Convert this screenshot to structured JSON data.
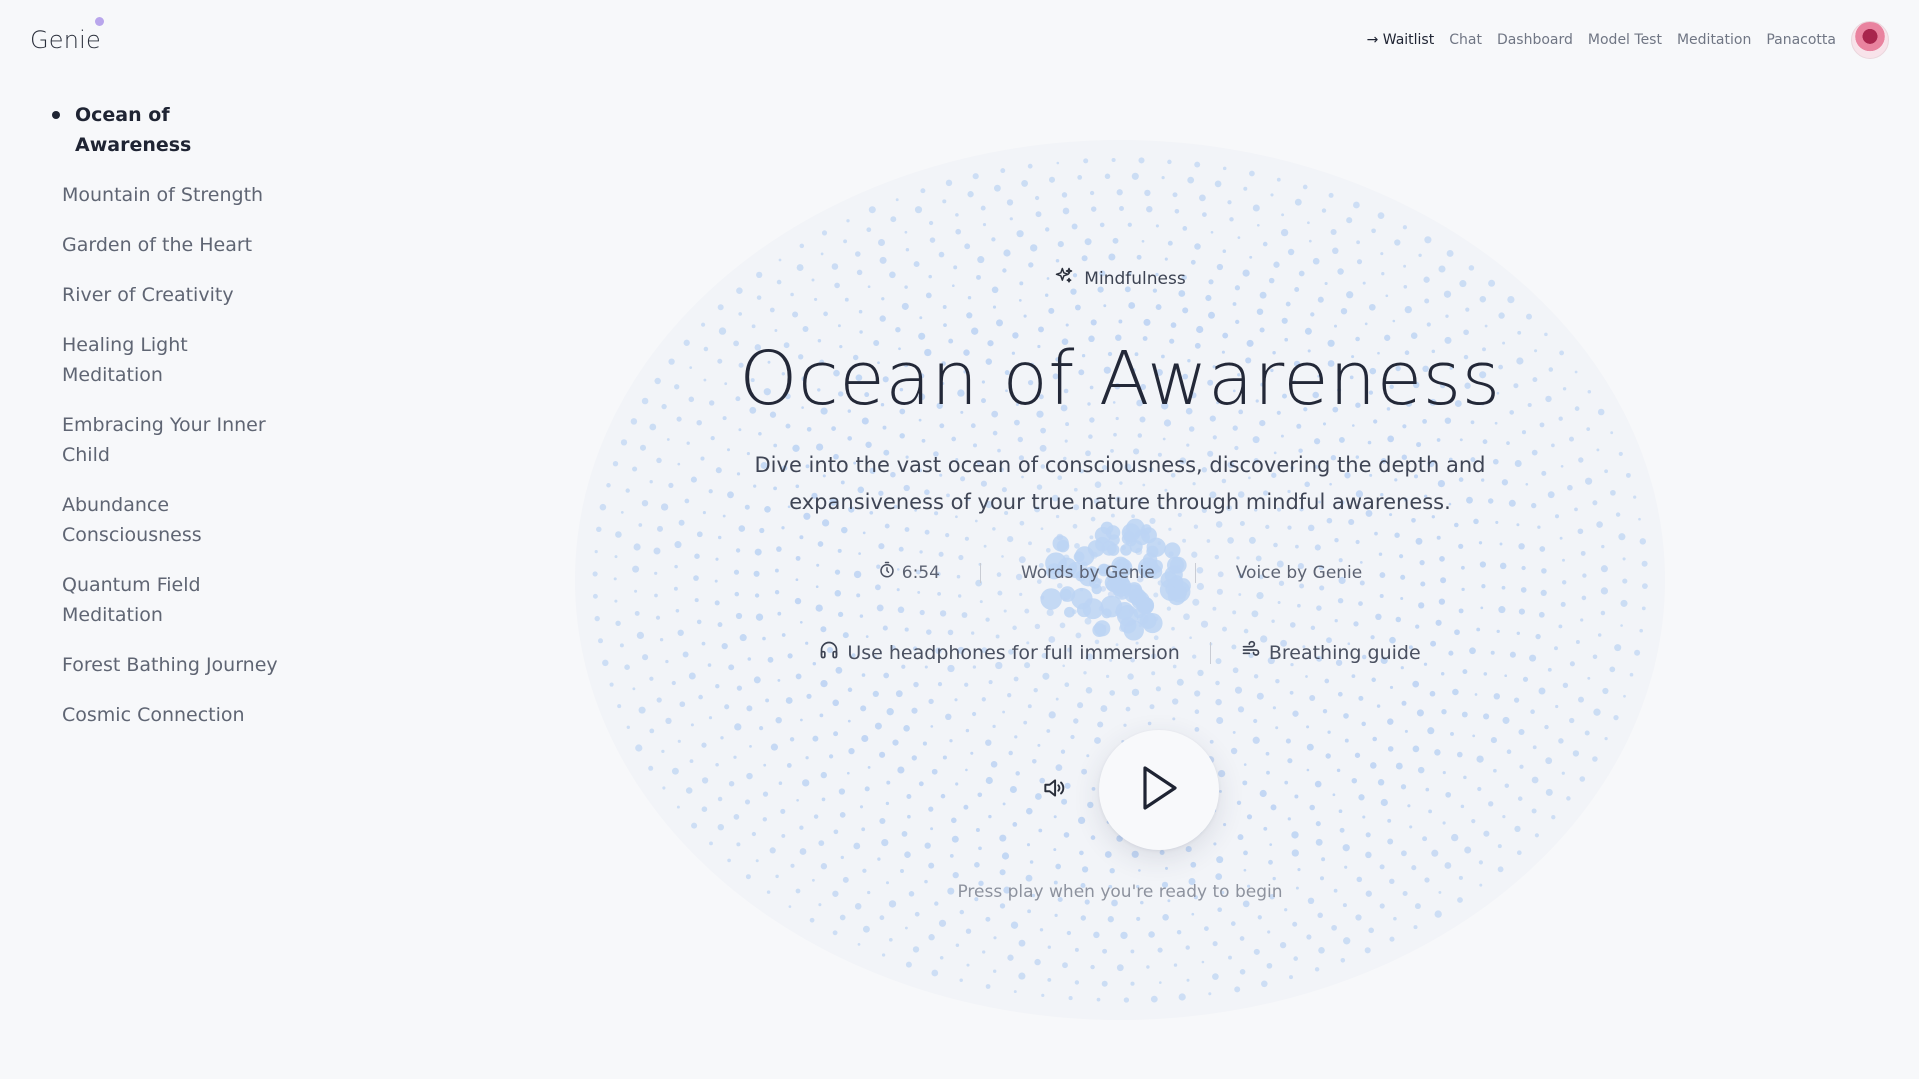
{
  "app": {
    "logo": "Genie"
  },
  "topnav": {
    "items": [
      {
        "label": "→ Waitlist"
      },
      {
        "label": "Chat"
      },
      {
        "label": "Dashboard"
      },
      {
        "label": "Model Test"
      },
      {
        "label": "Meditation"
      },
      {
        "label": "Panacotta"
      }
    ],
    "avatar_icon": "lotus-avatar"
  },
  "sidebar": {
    "items": [
      {
        "label": "Ocean of Awareness",
        "active": true
      },
      {
        "label": "Mountain of Strength"
      },
      {
        "label": "Garden of the Heart"
      },
      {
        "label": "River of Creativity"
      },
      {
        "label": "Healing Light Meditation"
      },
      {
        "label": "Embracing Your Inner Child"
      },
      {
        "label": "Abundance Consciousness"
      },
      {
        "label": "Quantum Field Meditation"
      },
      {
        "label": "Forest Bathing Journey"
      },
      {
        "label": "Cosmic Connection"
      }
    ]
  },
  "meditation": {
    "category": "Mindfulness",
    "category_icon": "sparkles-icon",
    "title": "Ocean of Awareness",
    "description": "Dive into the vast ocean of consciousness, discovering the depth and expansiveness of your true nature through mindful awareness.",
    "duration": "6:54",
    "duration_icon": "timer-icon",
    "words_by": "Words by Genie",
    "voice_by": "Voice by Genie",
    "tip_headphones": "Use headphones for full immersion",
    "tip_breathing": "Breathing guide",
    "hint": "Press play when you're ready to begin"
  },
  "colors": {
    "dot": "#bcd3f3",
    "accent_dot": "#b9a6ec",
    "text_primary": "#1f2433"
  }
}
